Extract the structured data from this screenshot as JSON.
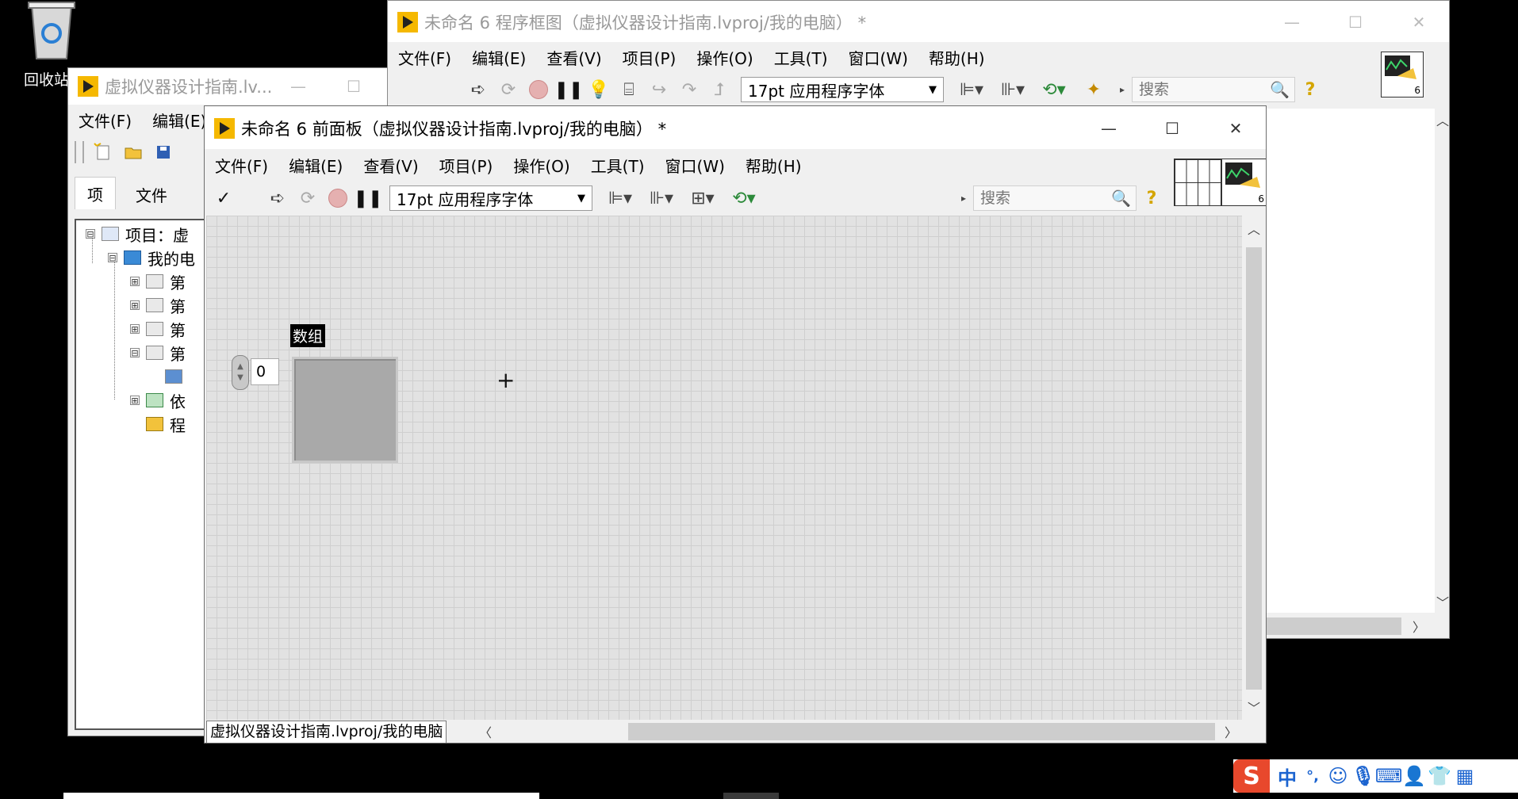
{
  "desktop": {
    "recycle_bin_label": "回收站"
  },
  "project_window": {
    "title": "虚拟仪器设计指南.lv...",
    "menu": [
      "文件(F)",
      "编辑(E)"
    ],
    "tabs": [
      "项",
      "文件"
    ],
    "tree": [
      {
        "label": "项目：虚",
        "expander": "⊟"
      },
      {
        "label": "我的电",
        "expander": "⊟"
      },
      {
        "label": "第",
        "expander": "⊞"
      },
      {
        "label": "第",
        "expander": "⊞"
      },
      {
        "label": "第",
        "expander": "⊞"
      },
      {
        "label": "第",
        "expander": "⊟"
      },
      {
        "label": "",
        "expander": ""
      },
      {
        "label": "依",
        "expander": "⊞"
      },
      {
        "label": "程",
        "expander": ""
      }
    ]
  },
  "block_diagram": {
    "title": "未命名 6 程序框图（虚拟仪器设计指南.lvproj/我的电脑） *",
    "menu": [
      "文件(F)",
      "编辑(E)",
      "查看(V)",
      "项目(P)",
      "操作(O)",
      "工具(T)",
      "窗口(W)",
      "帮助(H)"
    ],
    "font_select": "17pt 应用程序字体",
    "search_placeholder": "搜索",
    "vi_icon_number": "6"
  },
  "front_panel": {
    "title": "未命名 6 前面板（虚拟仪器设计指南.lvproj/我的电脑） *",
    "menu": [
      "文件(F)",
      "编辑(E)",
      "查看(V)",
      "项目(P)",
      "操作(O)",
      "工具(T)",
      "窗口(W)",
      "帮助(H)"
    ],
    "run_check": "✓",
    "font_select": "17pt 应用程序字体",
    "search_placeholder": "搜索",
    "vi_icon_number": "6",
    "array_label": "数组",
    "array_index": "0",
    "status_path": "虚拟仪器设计指南.lvproj/我的电脑"
  },
  "taskbar": {
    "ime_logo": "S",
    "ime_mode": "中",
    "ime_punct": "°,"
  },
  "colors": {
    "labview_logo": "#f5b800",
    "canvas": "#e2e2e2",
    "grid": "#cfcfcf",
    "ime_logo": "#e8482c"
  }
}
